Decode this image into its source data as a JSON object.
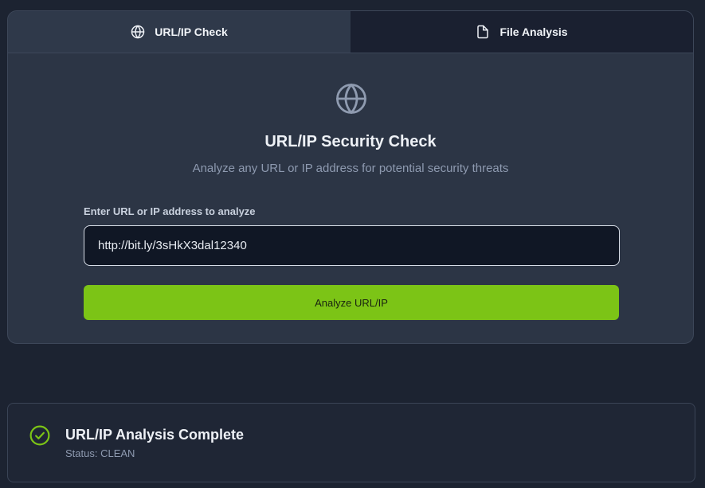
{
  "tabs": [
    {
      "label": "URL/IP Check",
      "icon": "globe-icon",
      "active": true
    },
    {
      "label": "File Analysis",
      "icon": "file-icon",
      "active": false
    }
  ],
  "main": {
    "hero_icon": "globe-icon",
    "title": "URL/IP Security Check",
    "subtitle": "Analyze any URL or IP address for potential security threats",
    "input_label": "Enter URL or IP address to analyze",
    "input_value": "http://bit.ly/3sHkX3dal12340",
    "button_label": "Analyze URL/IP"
  },
  "result": {
    "icon": "check-circle-icon",
    "title": "URL/IP Analysis Complete",
    "status": "Status: CLEAN"
  },
  "colors": {
    "accent": "#7cc416",
    "background": "#1c2331",
    "card": "#2c3545"
  }
}
